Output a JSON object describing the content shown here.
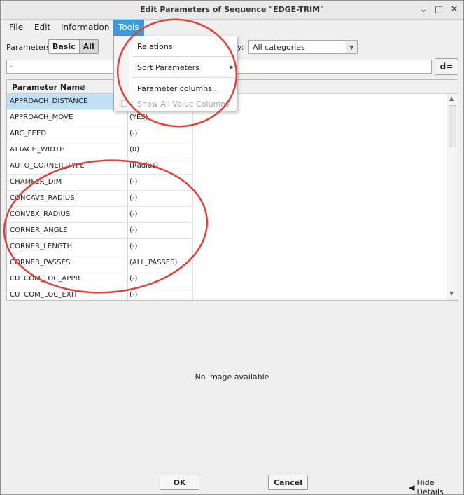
{
  "window": {
    "title": "Edit Parameters of Sequence \"EDGE-TRIM\"",
    "minimize_glyph": "⌄",
    "maximize_glyph": "□",
    "close_glyph": "✕"
  },
  "menubar": {
    "items": [
      {
        "label": "File"
      },
      {
        "label": "Edit"
      },
      {
        "label": "Information"
      },
      {
        "label": "Tools"
      }
    ],
    "active": "Tools"
  },
  "toolbar": {
    "parameters_label": "Parameters",
    "basic_label": "Basic",
    "all_label": "All",
    "category_label_visible": "y:",
    "category_value": "All categories",
    "dropdown_arrow": "▼"
  },
  "search": {
    "value": "-"
  },
  "formula_button": {
    "label": "d="
  },
  "tools_menu": {
    "items": [
      {
        "label": "Relations",
        "enabled": true
      },
      {
        "label": "Sort Parameters",
        "enabled": true,
        "has_submenu": true
      },
      {
        "label": "Parameter columns..",
        "enabled": true
      },
      {
        "label": "Show All Value Columns",
        "enabled": false
      }
    ],
    "submenu_arrow": "▶"
  },
  "table": {
    "header_name": "Parameter Name",
    "sort_icon": "▲▼",
    "rows": [
      {
        "name": "APPROACH_DISTANCE",
        "value": ""
      },
      {
        "name": "APPROACH_MOVE",
        "value": "(YES)"
      },
      {
        "name": "ARC_FEED",
        "value": "(-)"
      },
      {
        "name": "ATTACH_WIDTH",
        "value": "(0)"
      },
      {
        "name": "AUTO_CORNER_TYPE",
        "value": "(Radius)"
      },
      {
        "name": "CHAMFER_DIM",
        "value": "(-)"
      },
      {
        "name": "CONCAVE_RADIUS",
        "value": "(-)"
      },
      {
        "name": "CONVEX_RADIUS",
        "value": "(-)"
      },
      {
        "name": "CORNER_ANGLE",
        "value": "(-)"
      },
      {
        "name": "CORNER_LENGTH",
        "value": "(-)"
      },
      {
        "name": "CORNER_PASSES",
        "value": "(ALL_PASSES)"
      },
      {
        "name": "CUTCOM_LOC_APPR",
        "value": "(-)"
      },
      {
        "name": "CUTCOM_LOC_EXIT",
        "value": "(-)"
      }
    ],
    "selected_row": "APPROACH_DISTANCE",
    "scroll_up": "▲",
    "scroll_down": "▼"
  },
  "preview": {
    "message": "No image available"
  },
  "footer": {
    "ok_label": "OK",
    "cancel_label": "Cancel",
    "hide_details_label": "Hide Details",
    "hide_details_icon": "◀"
  },
  "colors": {
    "menu_active_bg": "#3c9be0",
    "selected_row_bg": "#bfe0f7",
    "annotation_red": "#e0403a"
  }
}
